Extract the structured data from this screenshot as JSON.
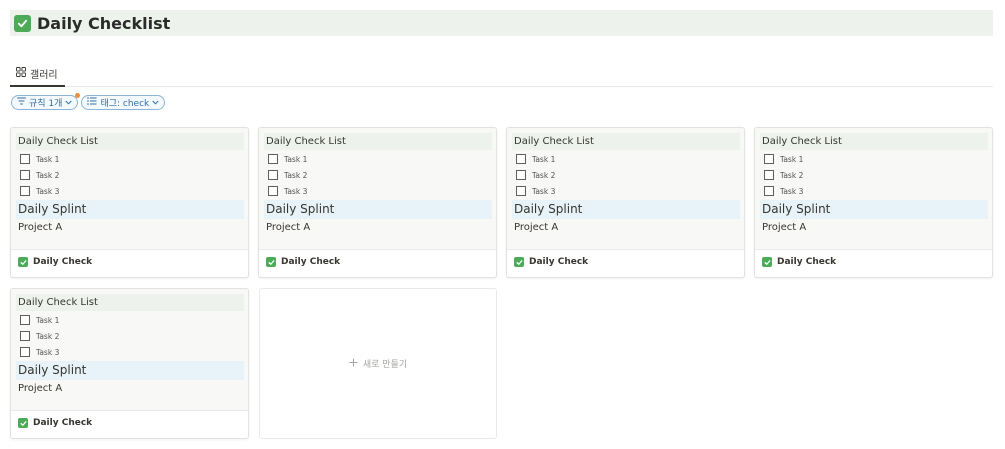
{
  "page": {
    "title": "Daily Checklist",
    "title_icon": "check-mark-button-icon",
    "accent": "#4daa57"
  },
  "tabs": [
    {
      "label": "갤러리",
      "icon": "gallery-grid-icon",
      "active": true
    }
  ],
  "filters": [
    {
      "label": "규칙 1개",
      "icon": "filter-icon",
      "has_dot": true
    },
    {
      "label": "태그: check",
      "icon": "list-icon"
    }
  ],
  "cards": [
    {
      "checklist_title": "Daily Check List",
      "tasks": [
        "Task 1",
        "Task 2",
        "Task 3"
      ],
      "splint": "Daily Splint",
      "project": "Project A",
      "footer": "Daily Check"
    },
    {
      "checklist_title": "Daily Check List",
      "tasks": [
        "Task 1",
        "Task 2",
        "Task 3"
      ],
      "splint": "Daily Splint",
      "project": "Project A",
      "footer": "Daily Check"
    },
    {
      "checklist_title": "Daily Check List",
      "tasks": [
        "Task 1",
        "Task 2",
        "Task 3"
      ],
      "splint": "Daily Splint",
      "project": "Project A",
      "footer": "Daily Check"
    },
    {
      "checklist_title": "Daily Check List",
      "tasks": [
        "Task 1",
        "Task 2",
        "Task 3"
      ],
      "splint": "Daily Splint",
      "project": "Project A",
      "footer": "Daily Check"
    },
    {
      "checklist_title": "Daily Check List",
      "tasks": [
        "Task 1",
        "Task 2",
        "Task 3"
      ],
      "splint": "Daily Splint",
      "project": "Project A",
      "footer": "Daily Check"
    }
  ],
  "new_card": {
    "label": "새로 만들기",
    "icon": "plus-icon"
  }
}
